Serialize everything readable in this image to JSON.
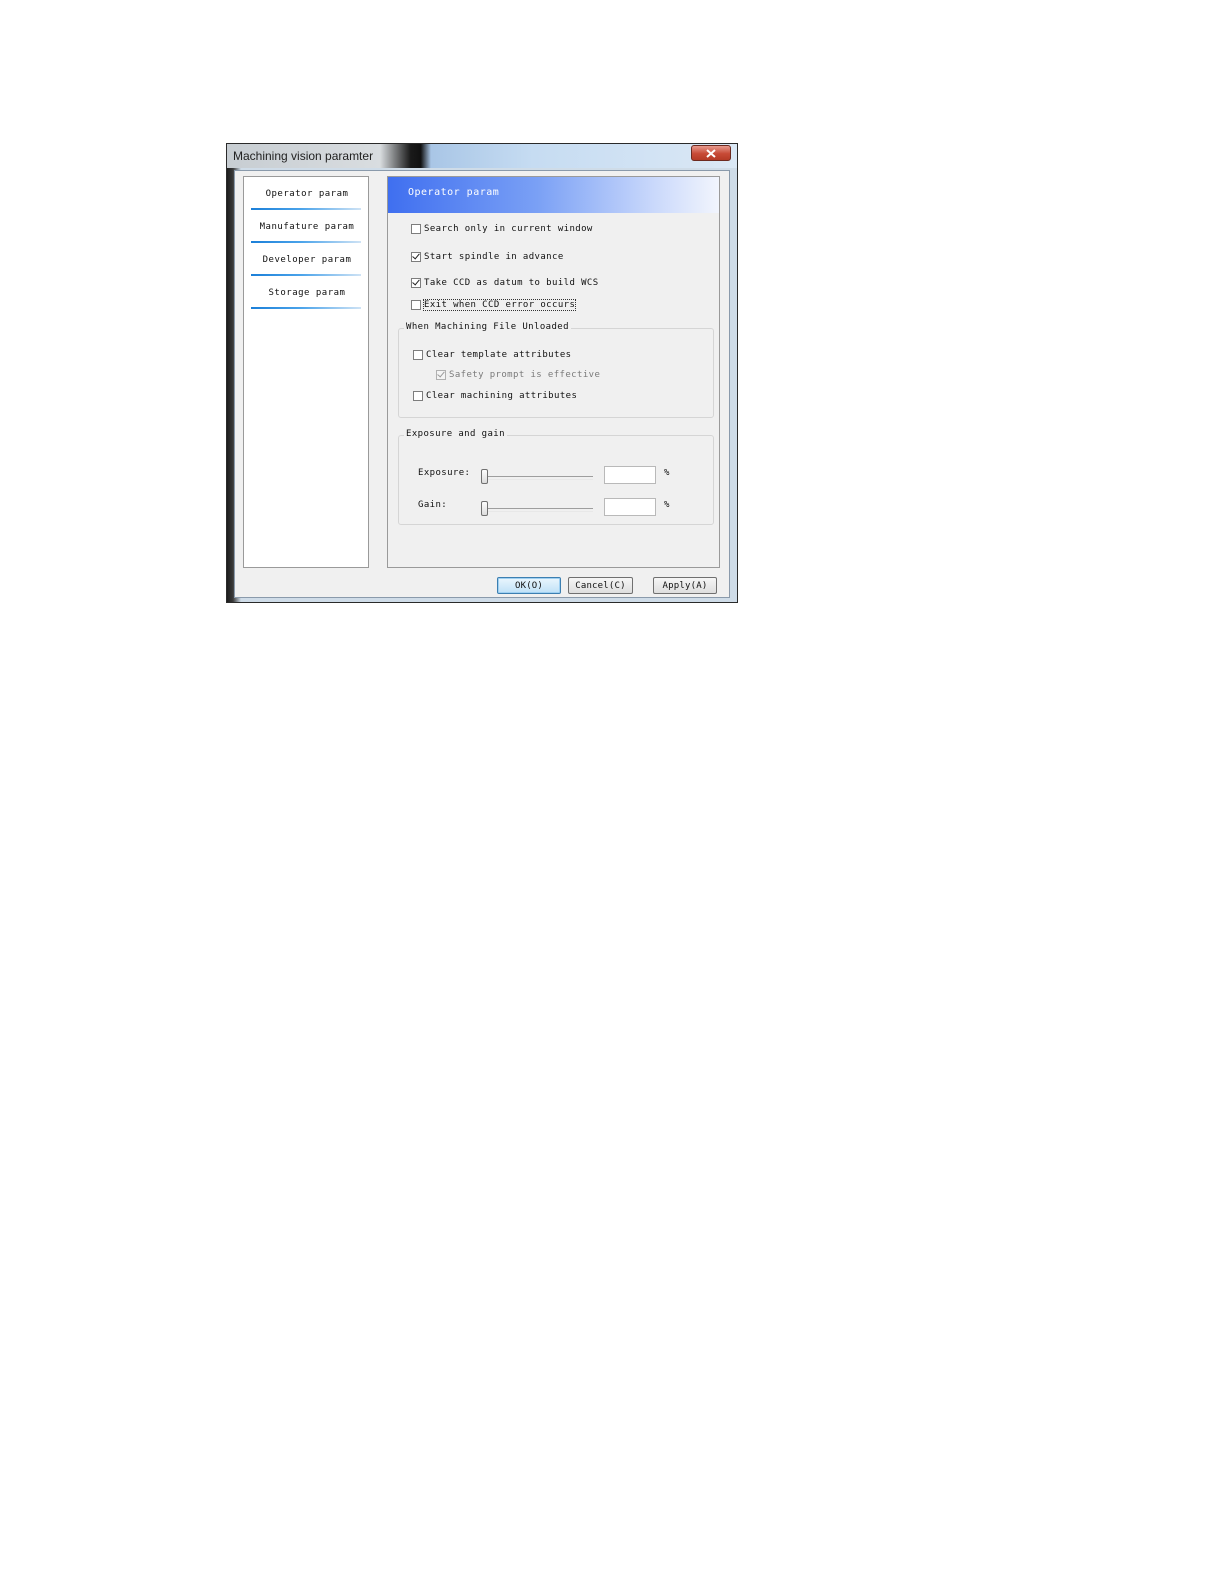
{
  "window": {
    "title": "Machining vision paramter",
    "close_label": "close"
  },
  "nav": {
    "items": [
      {
        "label": "Operator param"
      },
      {
        "label": "Manufature param"
      },
      {
        "label": "Developer param"
      },
      {
        "label": "Storage param"
      }
    ]
  },
  "content": {
    "header": "Operator param",
    "options": [
      {
        "label": "Search only in current window",
        "checked": false
      },
      {
        "label": "Start spindle in advance",
        "checked": true
      },
      {
        "label": "Take CCD as datum to build WCS",
        "checked": true
      },
      {
        "label": "Exit when CCD error occurs",
        "checked": false
      }
    ],
    "unload_group": {
      "title": "When Machining File Unloaded",
      "clear_template": {
        "label": "Clear template attributes",
        "checked": false
      },
      "safety_prompt": {
        "label": "Safety prompt is effective",
        "checked": true
      },
      "clear_machining": {
        "label": "Clear machining attributes",
        "checked": false
      }
    },
    "exposure_group": {
      "title": "Exposure and gain",
      "exposure": {
        "label": "Exposure:",
        "value": "",
        "unit": "%",
        "level": 0
      },
      "gain": {
        "label": "Gain:",
        "value": "",
        "unit": "%",
        "level": 0
      }
    }
  },
  "buttons": {
    "ok": "OK(O)",
    "cancel": "Cancel(C)",
    "apply": "Apply(A)"
  }
}
